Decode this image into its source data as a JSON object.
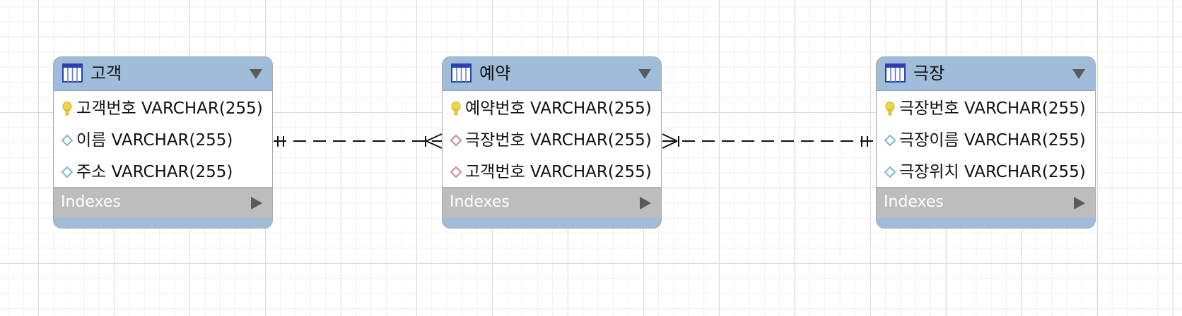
{
  "entities": [
    {
      "title": "고객",
      "columns": [
        {
          "icon": "primary-key-icon",
          "text": "고객번호 VARCHAR(255)"
        },
        {
          "icon": "column-diamond-icon",
          "text": "이름 VARCHAR(255)"
        },
        {
          "icon": "column-diamond-icon",
          "text": "주소 VARCHAR(255)"
        }
      ],
      "indexes_label": "Indexes"
    },
    {
      "title": "예약",
      "columns": [
        {
          "icon": "primary-key-icon",
          "text": "예약번호 VARCHAR(255)"
        },
        {
          "icon": "foreign-key-diamond-icon",
          "text": "극장번호 VARCHAR(255)"
        },
        {
          "icon": "foreign-key-diamond-icon",
          "text": "고객번호 VARCHAR(255)"
        }
      ],
      "indexes_label": "Indexes"
    },
    {
      "title": "극장",
      "columns": [
        {
          "icon": "primary-key-icon",
          "text": "극장번호 VARCHAR(255)"
        },
        {
          "icon": "column-diamond-icon",
          "text": "극장이름 VARCHAR(255)"
        },
        {
          "icon": "column-diamond-icon",
          "text": "극장위치 VARCHAR(255)"
        }
      ],
      "indexes_label": "Indexes"
    }
  ],
  "relationships": [
    {
      "from": "고객",
      "to": "예약",
      "from_end": "one-and-only-one",
      "to_end": "one-or-many",
      "line_style": "dashed"
    },
    {
      "from": "예약",
      "to": "극장",
      "from_end": "one-or-many",
      "to_end": "one-and-only-one",
      "line_style": "dashed"
    }
  ],
  "colors": {
    "header": "#9fbcd8",
    "indexes_bar": "#bdbdbd",
    "key": "#e8c93a",
    "column_diamond": "#7fb6c6",
    "foreign_key_diamond": "#c98a84"
  }
}
